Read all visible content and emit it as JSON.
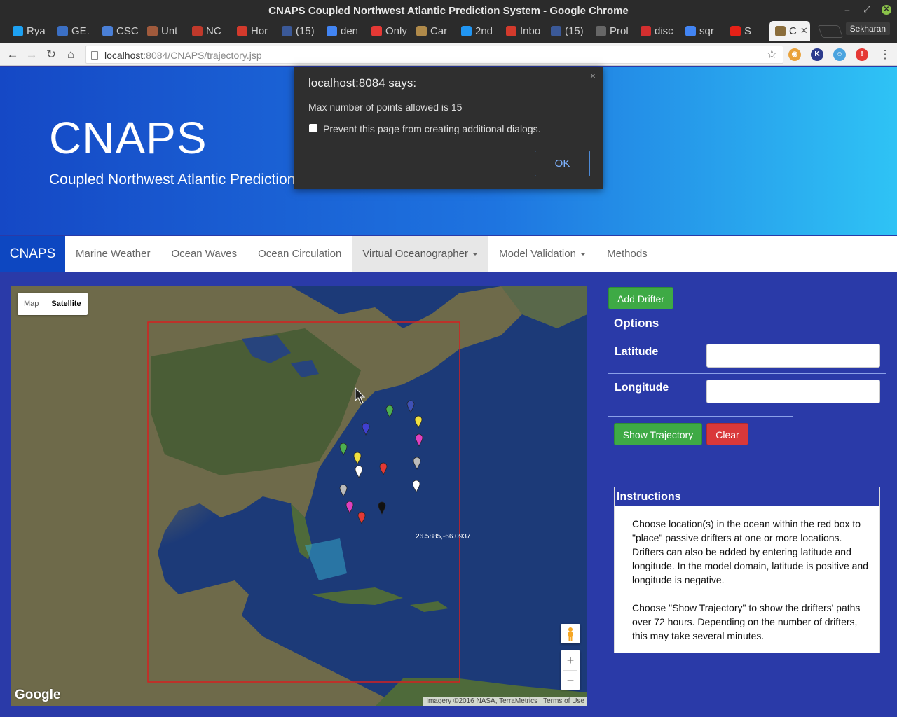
{
  "window": {
    "title": "CNAPS Coupled Northwest Atlantic Prediction System - Google Chrome",
    "profile": "Sekharan"
  },
  "tabs": [
    {
      "label": "Rya",
      "favicon": "twitter-icon",
      "color": "#1da1f2"
    },
    {
      "label": "GE.",
      "favicon": "ge-icon",
      "color": "#3b6fc4"
    },
    {
      "label": "CSC",
      "favicon": "p-icon",
      "color": "#4a7fd6"
    },
    {
      "label": "Unt",
      "favicon": "face-icon",
      "color": "#a05a3c"
    },
    {
      "label": "NC",
      "favicon": "nc-icon",
      "color": "#c0392b"
    },
    {
      "label": "Hor",
      "favicon": "gmail-icon",
      "color": "#d33a2c"
    },
    {
      "label": "(15)",
      "favicon": "facebook-icon",
      "color": "#3b5998"
    },
    {
      "label": "den",
      "favicon": "google-icon",
      "color": "#4285f4"
    },
    {
      "label": "Only",
      "favicon": "chart-icon",
      "color": "#e53935"
    },
    {
      "label": "Car",
      "favicon": "car-icon",
      "color": "#b08a4a"
    },
    {
      "label": "2nd",
      "favicon": "c-icon",
      "color": "#2196f3"
    },
    {
      "label": "Inbo",
      "favicon": "gmail-icon",
      "color": "#d33a2c"
    },
    {
      "label": "(15)",
      "favicon": "facebook-icon",
      "color": "#3b5998"
    },
    {
      "label": "Prol",
      "favicon": "book-icon",
      "color": "#666666"
    },
    {
      "label": "disc",
      "favicon": "gear-icon",
      "color": "#d32f2f"
    },
    {
      "label": "sqr",
      "favicon": "google-icon",
      "color": "#4285f4"
    },
    {
      "label": "S",
      "favicon": "youtube-icon",
      "color": "#e62117"
    },
    {
      "label": "C",
      "favicon": "cnaps-icon",
      "color": "#8a6d3b"
    }
  ],
  "address": {
    "host": "localhost",
    "rest": ":8084/CNAPS/trajectory.jsp"
  },
  "hero": {
    "title": "CNAPS",
    "subtitle": "Coupled Northwest Atlantic Prediction System"
  },
  "nav": {
    "brand": "CNAPS",
    "items": [
      "Marine Weather",
      "Ocean Waves",
      "Ocean Circulation",
      "Virtual Oceanographer",
      "Model Validation",
      "Methods"
    ]
  },
  "map": {
    "mode_map": "Map",
    "mode_satellite": "Satellite",
    "coords": "26.5885,-66.0937",
    "attribution": "Imagery ©2016 NASA, TerraMetrics",
    "terms": "Terms of Use",
    "logo": "Google",
    "zoom_in": "+",
    "zoom_out": "−",
    "drifters": [
      {
        "color": "#4caf50"
      },
      {
        "color": "#3f51b5"
      },
      {
        "color": "#4040d0"
      },
      {
        "color": "#f0e040"
      },
      {
        "color": "#e040c0"
      },
      {
        "color": "#4caf50"
      },
      {
        "color": "#f0e040"
      },
      {
        "color": "#e53935"
      },
      {
        "color": "#bbbbbb"
      },
      {
        "color": "#ffffff"
      },
      {
        "color": "#ffffff"
      },
      {
        "color": "#bbbbbb"
      },
      {
        "color": "#e040c0"
      },
      {
        "color": "#111111"
      },
      {
        "color": "#e53935"
      }
    ]
  },
  "panel": {
    "add_drifter": "Add Drifter",
    "options_title": "Options",
    "latitude_label": "Latitude",
    "longitude_label": "Longitude",
    "latitude_value": "",
    "longitude_value": "",
    "show_trajectory": "Show Trajectory",
    "clear": "Clear",
    "instructions_title": "Instructions",
    "instructions_p1": "Choose location(s) in the ocean within the red box to \"place\" passive drifters at one or more locations. Drifters can also be added by entering latitude and longitude. In the model domain, latitude is positive and longitude is negative.",
    "instructions_p2": "Choose \"Show Trajectory\" to show the drifters' paths over 72 hours. Depending on the number of drifters, this may take several minutes."
  },
  "dialog": {
    "title": "localhost:8084 says:",
    "message": "Max number of points allowed is 15",
    "checkbox_label": "Prevent this page from creating additional dialogs.",
    "ok": "OK",
    "close": "×"
  }
}
